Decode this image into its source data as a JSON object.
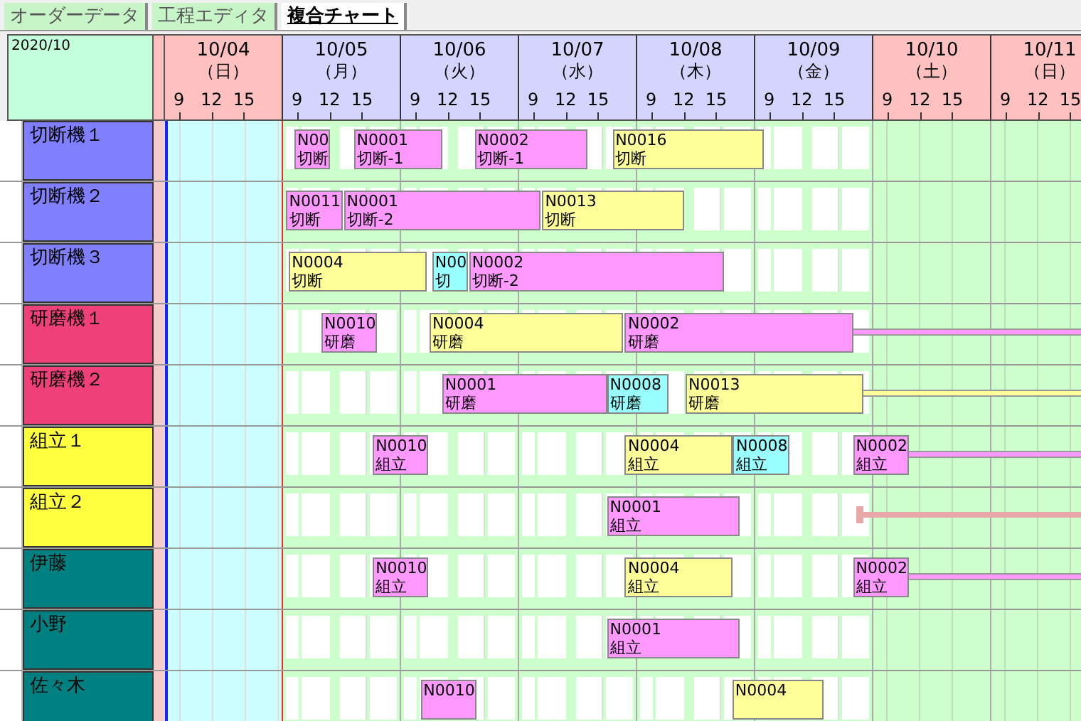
{
  "tabs": [
    {
      "label": "オーダーデータ",
      "selected": false
    },
    {
      "label": "工程エディタ",
      "selected": false
    },
    {
      "label": "複合チャート",
      "selected": true
    }
  ],
  "header": {
    "month": "2020/10",
    "days": [
      {
        "date": "10/04",
        "weekday": "（日）",
        "holiday": true,
        "past": true,
        "ticks": [
          "9",
          "12",
          "15"
        ]
      },
      {
        "date": "10/05",
        "weekday": "（月）",
        "holiday": false,
        "past": false,
        "ticks": [
          "9",
          "12",
          "15"
        ]
      },
      {
        "date": "10/06",
        "weekday": "（火）",
        "holiday": false,
        "past": false,
        "ticks": [
          "9",
          "12",
          "15"
        ]
      },
      {
        "date": "10/07",
        "weekday": "（水）",
        "holiday": false,
        "past": false,
        "ticks": [
          "9",
          "12",
          "15"
        ]
      },
      {
        "date": "10/08",
        "weekday": "（木）",
        "holiday": false,
        "past": false,
        "ticks": [
          "9",
          "12",
          "15"
        ]
      },
      {
        "date": "10/09",
        "weekday": "（金）",
        "holiday": false,
        "past": false,
        "ticks": [
          "9",
          "12",
          "15"
        ]
      },
      {
        "date": "10/10",
        "weekday": "（土）",
        "holiday": true,
        "past": false,
        "ticks": [
          "9",
          "12",
          "15"
        ]
      },
      {
        "date": "10/11",
        "weekday": "（日）",
        "holiday": true,
        "past": false,
        "ticks": [
          "9",
          "12",
          "15"
        ]
      }
    ]
  },
  "resources": [
    {
      "name": "切断機１",
      "color": "#8080ff",
      "tasks": [
        {
          "kind": "task",
          "order": "N00",
          "operation": "切断",
          "color": "#ff99ff",
          "continues": false
        },
        {
          "kind": "task",
          "order": "N0001",
          "operation": "切断-1",
          "color": "#ff99ff",
          "continues": false
        },
        {
          "kind": "task",
          "order": "N0002",
          "operation": "切断-1",
          "color": "#ff99ff",
          "continues": false
        },
        {
          "kind": "task",
          "order": "N0016",
          "operation": "切断",
          "color": "#ffff99",
          "continues": false
        }
      ]
    },
    {
      "name": "切断機２",
      "color": "#8080ff",
      "tasks": [
        {
          "kind": "task",
          "order": "N0011",
          "operation": "切断",
          "color": "#ff99ff",
          "continues": false
        },
        {
          "kind": "task",
          "order": "N0001",
          "operation": "切断-2",
          "color": "#ff99ff",
          "continues": false
        },
        {
          "kind": "task",
          "order": "N0013",
          "operation": "切断",
          "color": "#ffff99",
          "continues": false
        }
      ]
    },
    {
      "name": "切断機３",
      "color": "#8080ff",
      "tasks": [
        {
          "kind": "task",
          "order": "N0004",
          "operation": "切断",
          "color": "#ffff99",
          "continues": false
        },
        {
          "kind": "task",
          "order": "N00",
          "operation": "切",
          "color": "#99ffff",
          "continues": false
        },
        {
          "kind": "task",
          "order": "N0002",
          "operation": "切断-2",
          "color": "#ff99ff",
          "continues": false
        }
      ]
    },
    {
      "name": "研磨機１",
      "color": "#f0407a",
      "tasks": [
        {
          "kind": "task",
          "order": "N0010",
          "operation": "研磨",
          "color": "#ff99ff",
          "continues": false
        },
        {
          "kind": "task",
          "order": "N0004",
          "operation": "研磨",
          "color": "#ffff99",
          "continues": false
        },
        {
          "kind": "task",
          "order": "N0002",
          "operation": "研磨",
          "color": "#ff99ff",
          "continues": true
        }
      ]
    },
    {
      "name": "研磨機２",
      "color": "#f0407a",
      "tasks": [
        {
          "kind": "task",
          "order": "N0001",
          "operation": "研磨",
          "color": "#ff99ff",
          "continues": false
        },
        {
          "kind": "task",
          "order": "N0008",
          "operation": "研磨",
          "color": "#99ffff",
          "continues": false
        },
        {
          "kind": "task",
          "order": "N0013",
          "operation": "研磨",
          "color": "#ffff99",
          "continues": true
        }
      ]
    },
    {
      "name": "組立１",
      "color": "#ffff40",
      "tasks": [
        {
          "kind": "task",
          "order": "N0010",
          "operation": "組立",
          "color": "#ff99ff",
          "continues": false
        },
        {
          "kind": "task",
          "order": "N0004",
          "operation": "組立",
          "color": "#ffff99",
          "continues": false
        },
        {
          "kind": "task",
          "order": "N0008",
          "operation": "組立",
          "color": "#99ffff",
          "continues": false
        },
        {
          "kind": "task",
          "order": "N0002",
          "operation": "組立",
          "color": "#ff99ff",
          "continues": true
        }
      ]
    },
    {
      "name": "組立２",
      "color": "#ffff40",
      "tasks": [
        {
          "kind": "task",
          "order": "N0001",
          "operation": "組立",
          "color": "#ff99ff",
          "continues": false
        },
        {
          "kind": "link",
          "color": "#e8a8a8"
        }
      ]
    },
    {
      "name": "伊藤",
      "color": "#008080",
      "tasks": [
        {
          "kind": "task",
          "order": "N0010",
          "operation": "組立",
          "color": "#ff99ff",
          "continues": false
        },
        {
          "kind": "task",
          "order": "N0004",
          "operation": "組立",
          "color": "#ffff99",
          "continues": false
        },
        {
          "kind": "task",
          "order": "N0002",
          "operation": "組立",
          "color": "#ff99ff",
          "continues": true
        }
      ]
    },
    {
      "name": "小野",
      "color": "#008080",
      "tasks": [
        {
          "kind": "task",
          "order": "N0001",
          "operation": "組立",
          "color": "#ff99ff",
          "continues": false
        }
      ]
    },
    {
      "name": "佐々木",
      "color": "#008080",
      "tasks": [
        {
          "kind": "task",
          "order": "N0010",
          "color": "#ff99ff",
          "continues": false
        },
        {
          "kind": "task",
          "order": "N0004",
          "color": "#ffff99",
          "continues": false
        }
      ]
    }
  ]
}
